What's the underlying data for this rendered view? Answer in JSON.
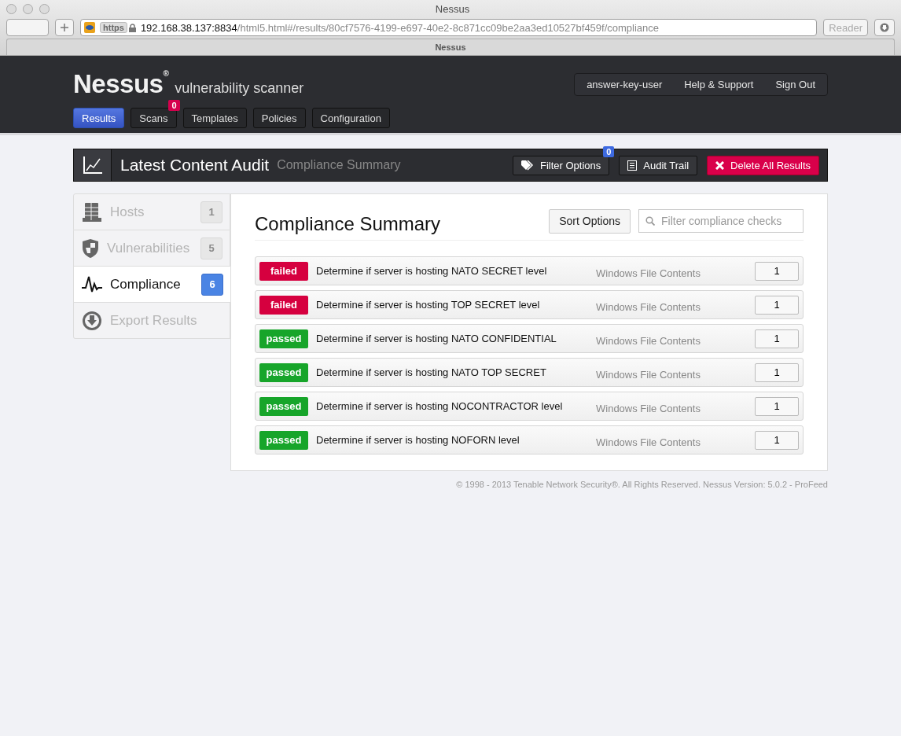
{
  "browser": {
    "title": "Nessus",
    "scheme": "https",
    "url_host": "192.168.38.137:8834",
    "url_path": "/html5.html#/results/80cf7576-4199-e697-40e2-8c871cc09be2aa3ed10527bf459f/compliance",
    "reader": "Reader",
    "tab_title": "Nessus"
  },
  "header": {
    "logo": "Nessus$^{®}$",
    "tagline": "vulnerability scanner",
    "nav": [
      {
        "label": "Results",
        "selected": true
      },
      {
        "label": "Scans",
        "selected": false,
        "badge": "0"
      },
      {
        "label": "Templates",
        "selected": false
      },
      {
        "label": "Policies",
        "selected": false
      },
      {
        "label": "Configuration",
        "selected": false
      }
    ],
    "user_menu": [
      "answer-key-user",
      "Help & Support",
      "Sign Out"
    ]
  },
  "toolbar": {
    "title": "Latest Content Audit",
    "subtitle": "Compliance Summary",
    "buttons": [
      {
        "kind": "filter",
        "label": "Filter Options",
        "badge": "0"
      },
      {
        "kind": "audit",
        "label": "Audit Trail"
      },
      {
        "kind": "delete",
        "label": "Delete All Results"
      }
    ]
  },
  "sidebar": {
    "items": [
      {
        "kind": "hosts",
        "label": "Hosts",
        "count": "1",
        "selected": false
      },
      {
        "kind": "vulnerabilities",
        "label": "Vulnerabilities",
        "count": "5",
        "selected": false
      },
      {
        "kind": "compliance",
        "label": "Compliance",
        "count": "6",
        "selected": true
      },
      {
        "kind": "export",
        "label": "Export Results",
        "selected": false
      }
    ]
  },
  "panel": {
    "title": "Compliance Summary",
    "sort_button": "Sort Options",
    "filter": {
      "placeholder": "Filter compliance checks"
    },
    "rows": [
      {
        "kind": "failed",
        "status": "failed",
        "check": "Determine if server is hosting NATO SECRET level",
        "family": "Windows File Contents",
        "count": "1"
      },
      {
        "kind": "failed",
        "status": "failed",
        "check": "Determine if server is hosting TOP SECRET level",
        "family": "Windows File Contents",
        "count": "1"
      },
      {
        "kind": "passed",
        "status": "passed",
        "check": "Determine if server is hosting NATO CONFIDENTIAL",
        "family": "Windows File Contents",
        "count": "1"
      },
      {
        "kind": "passed",
        "status": "passed",
        "check": "Determine if server is hosting NATO TOP SECRET",
        "family": "Windows File Contents",
        "count": "1"
      },
      {
        "kind": "passed",
        "status": "passed",
        "check": "Determine if server is hosting NOCONTRACTOR level",
        "family": "Windows File Contents",
        "count": "1"
      },
      {
        "kind": "passed",
        "status": "passed",
        "check": "Determine if server is hosting NOFORN level",
        "family": "Windows File Contents",
        "count": "1"
      }
    ]
  },
  "footer": "© 1998 - 2013 Tenable Network Security®. All Rights Reserved. Nessus Version: 5.0.2 - ProFeed"
}
